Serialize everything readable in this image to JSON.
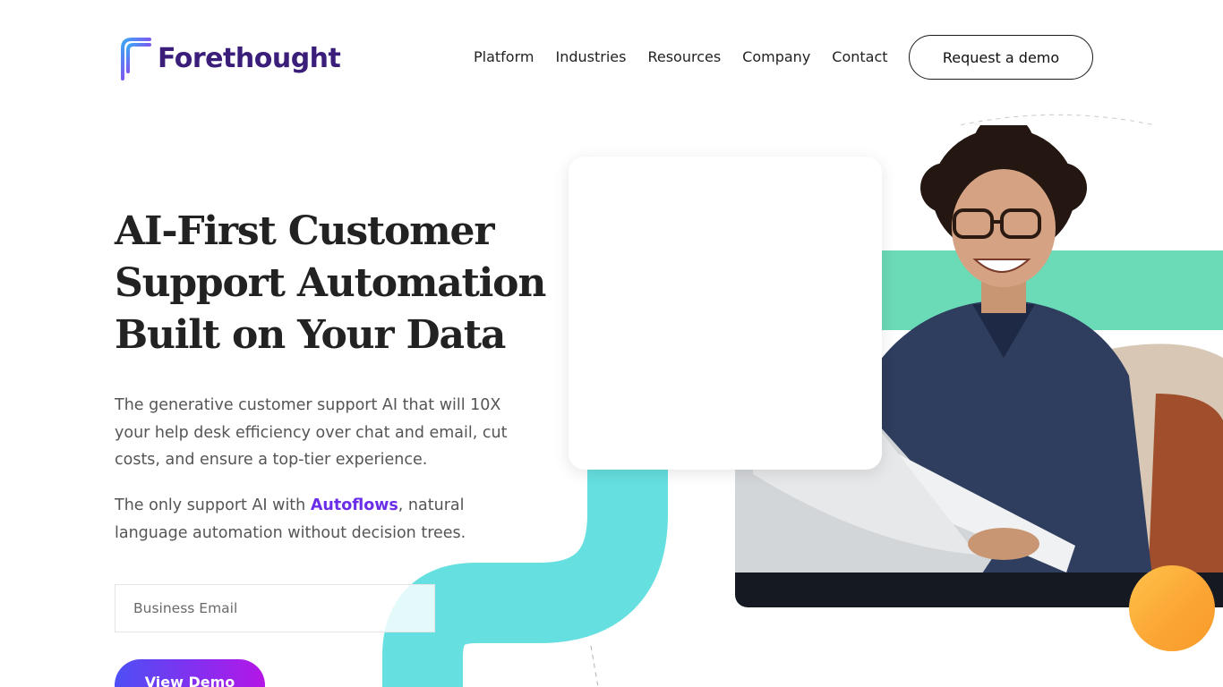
{
  "header": {
    "logo_text": "Forethought",
    "nav": [
      {
        "label": "Platform"
      },
      {
        "label": "Industries"
      },
      {
        "label": "Resources"
      },
      {
        "label": "Company"
      },
      {
        "label": "Contact"
      }
    ],
    "cta_label": "Request a demo"
  },
  "hero": {
    "headline_lines": [
      "AI-First Customer",
      "Support Automation",
      "Built on Your Data"
    ],
    "description": "The generative customer support AI that will 10X your help desk efficiency over chat and email, cut costs, and ensure a top-tier experience.",
    "desc2_prefix": "The only support AI with ",
    "desc2_link": "Autoflows",
    "desc2_suffix": ", natural language automation without decision trees.",
    "email_placeholder": "Business Email",
    "email_value": "",
    "view_demo_label": "View Demo"
  },
  "colors": {
    "brand_purple": "#3a1e7a",
    "link_purple": "#6b2ee8",
    "teal_shape": "#65dfe0",
    "green_band": "#6bdab6",
    "orange_circle": "#fba434",
    "cta_gradient_start": "#4d50f5",
    "cta_gradient_end": "#b416e6"
  },
  "icons": {
    "logo_mark": "forethought-f-logo-icon"
  }
}
